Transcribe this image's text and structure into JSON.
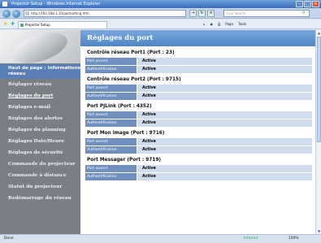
{
  "window": {
    "title": "Projector Setup - Windows Internet Explorer"
  },
  "browser": {
    "address": "http://192.168.1.10/portsetting.htm",
    "search_placeholder": "Live Search",
    "tab_title": "Projector Setup",
    "toolbar": [
      "Page",
      "Tools"
    ],
    "status_left": "Done",
    "status_zone": "Internet",
    "status_zoom": "100%"
  },
  "sidebar": {
    "items": [
      {
        "label": "Haut de page : Informations réseau"
      },
      {
        "label": "Réglages réseau"
      },
      {
        "label": "Réglages du port"
      },
      {
        "label": "Réglages e-mail"
      },
      {
        "label": "Réglages des alertes"
      },
      {
        "label": "Réglages du planning"
      },
      {
        "label": "Réglages Date/Heure"
      },
      {
        "label": "Réglages de sécurité"
      },
      {
        "label": "Commande du projecteur"
      },
      {
        "label": "Commande à distance"
      },
      {
        "label": "Statut du projecteur"
      },
      {
        "label": "Redémarrage du réseau"
      }
    ]
  },
  "main": {
    "title": "Réglages du port",
    "sections": [
      {
        "title": "Contrôle réseau Port1 (Port : 23)",
        "rows": [
          {
            "label": "Port ouvert",
            "value": "Active"
          },
          {
            "label": "Authentification",
            "value": "Active"
          }
        ]
      },
      {
        "title": "Contrôle réseau Port2 (Port : 9715)",
        "rows": [
          {
            "label": "Port ouvert",
            "value": "Active"
          },
          {
            "label": "Authentification",
            "value": "Active"
          }
        ]
      },
      {
        "title": "Port PJLink (Port : 4352)",
        "rows": [
          {
            "label": "Port ouvert",
            "value": "Active"
          },
          {
            "label": "Authentification",
            "value": "Active"
          }
        ]
      },
      {
        "title": "Port Mon image (Port : 9716)",
        "rows": [
          {
            "label": "Port ouvert",
            "value": "Active"
          },
          {
            "label": "Authentification",
            "value": "Active"
          }
        ]
      },
      {
        "title": "Port Messager (Port : 9719)",
        "rows": [
          {
            "label": "Port ouvert",
            "value": "Active"
          },
          {
            "label": "Authentification",
            "value": "Active"
          }
        ]
      }
    ]
  }
}
